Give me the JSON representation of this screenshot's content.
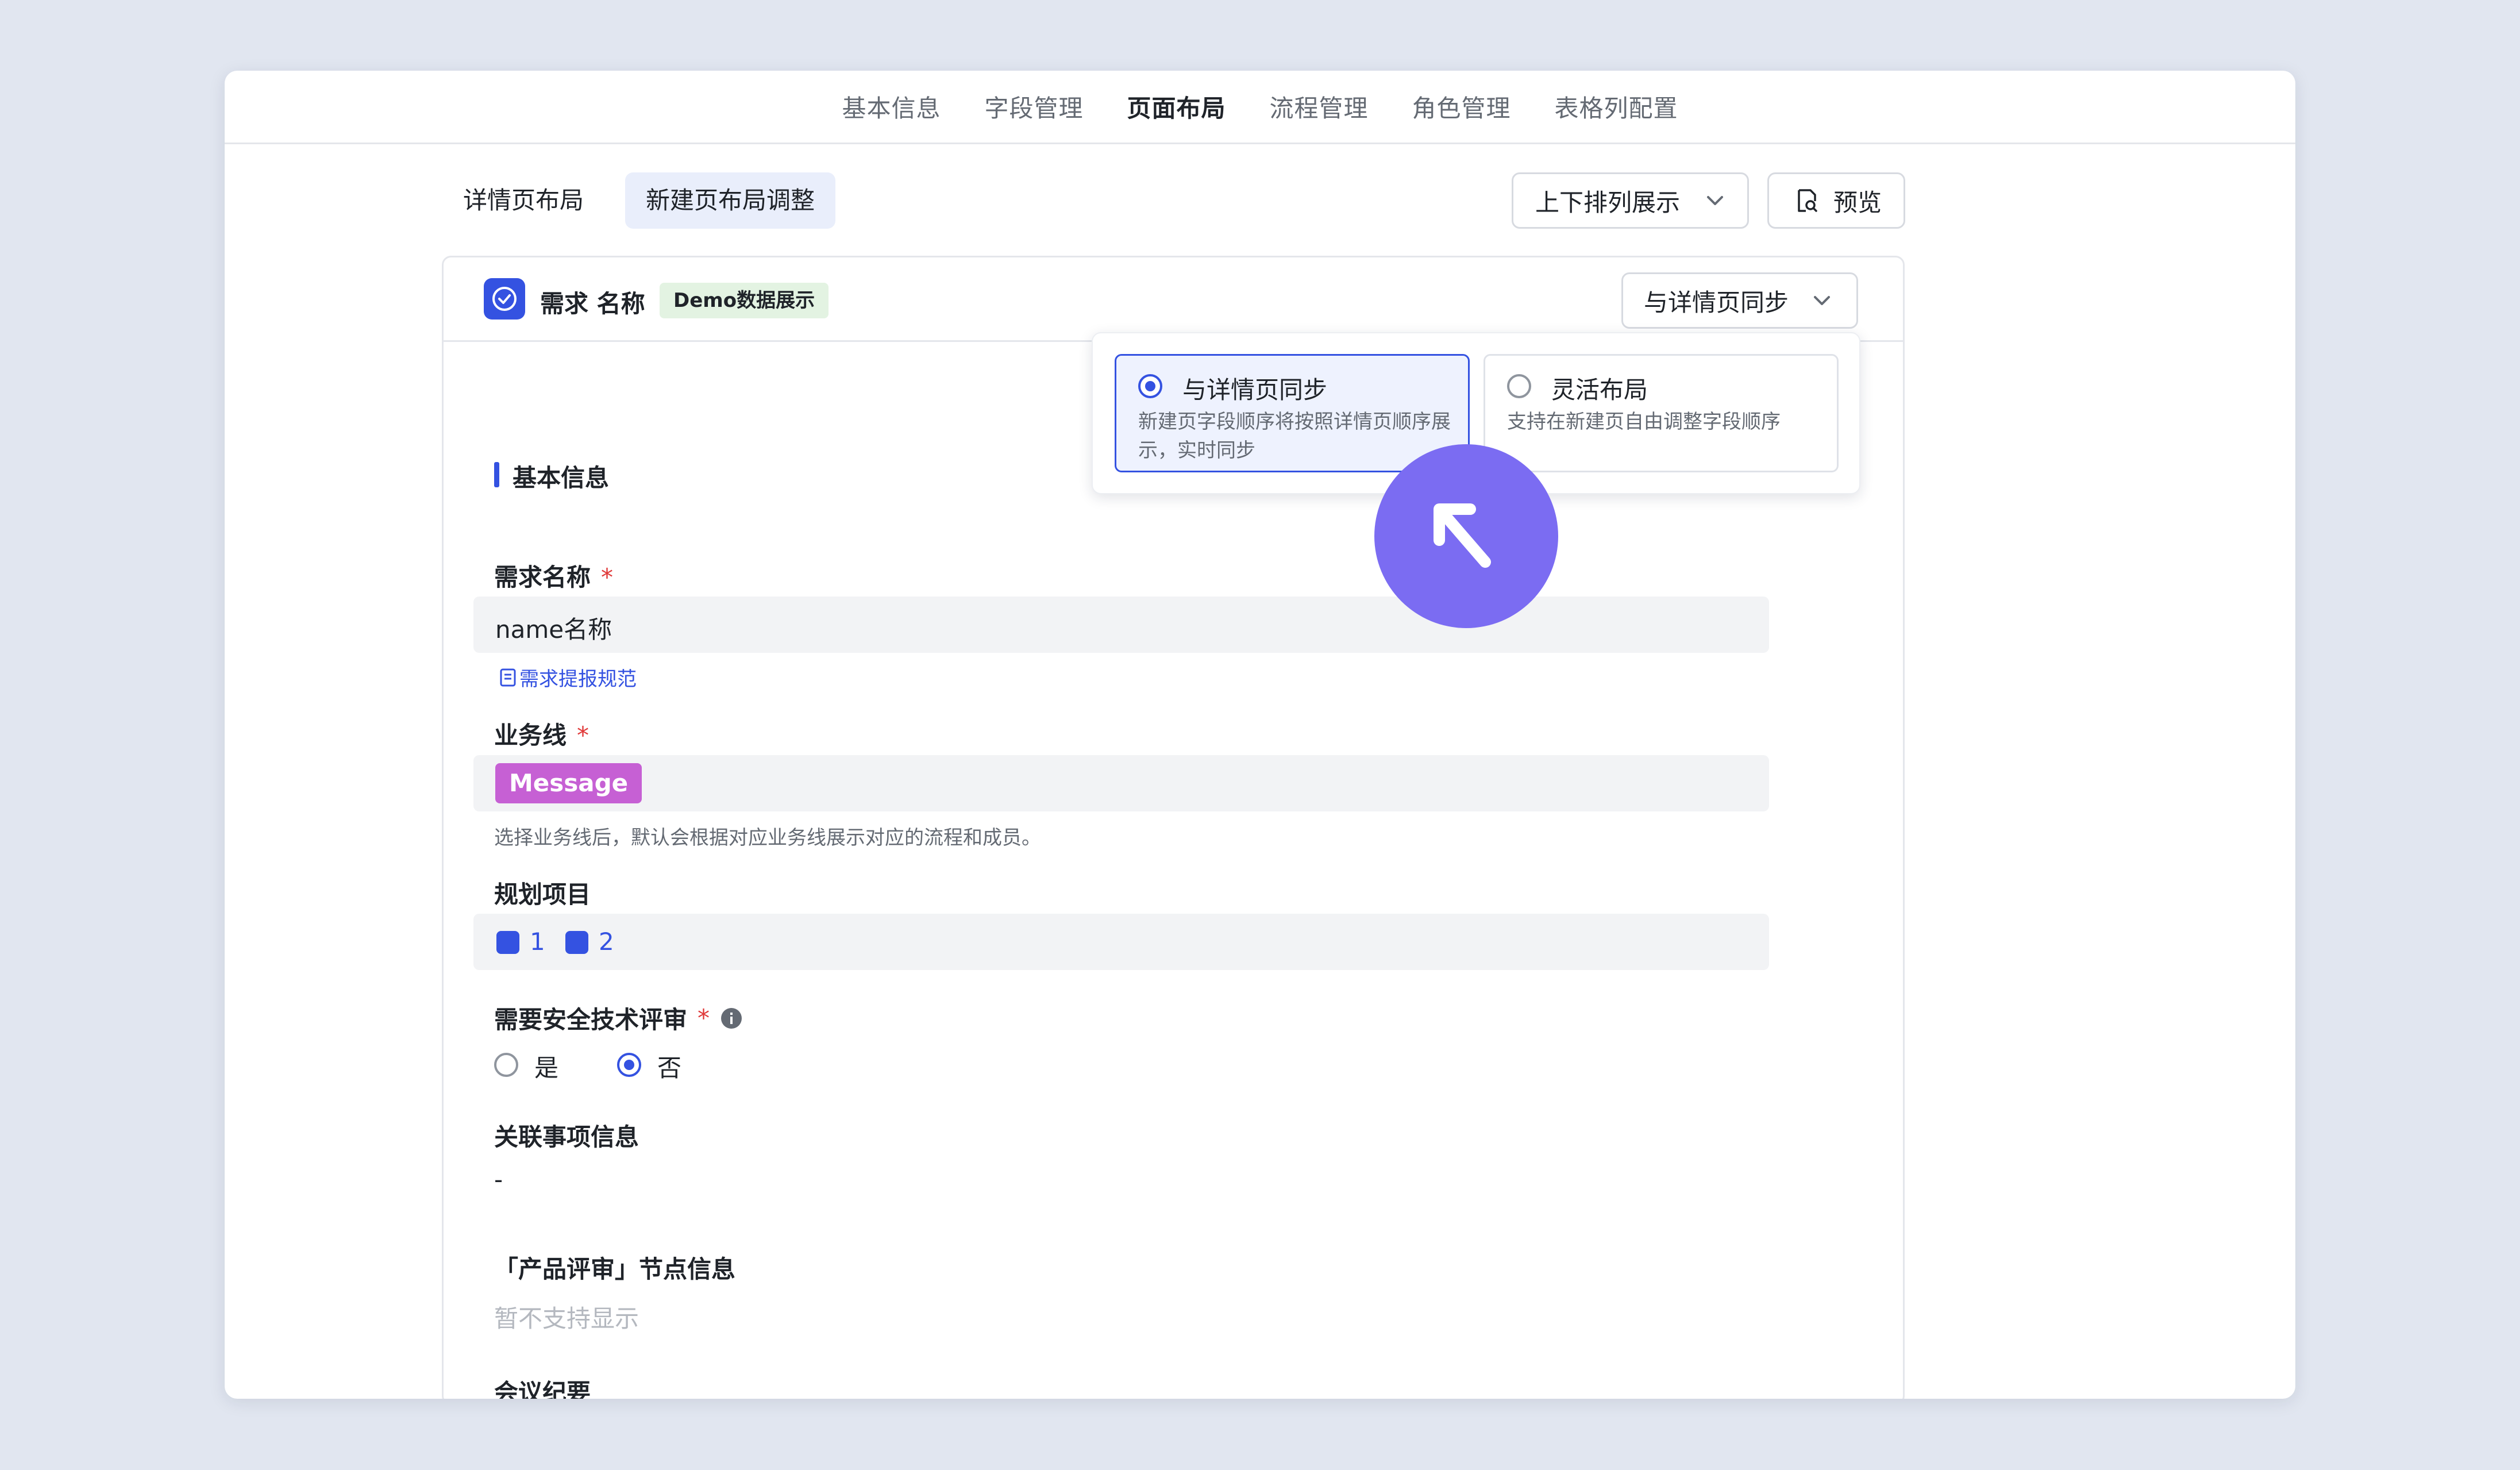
{
  "top_nav": {
    "tabs": [
      "基本信息",
      "字段管理",
      "页面布局",
      "流程管理",
      "角色管理",
      "表格列配置"
    ],
    "active_index": 2
  },
  "sub_tabs": {
    "detail": "详情页布局",
    "new": "新建页布局调整"
  },
  "toolbar": {
    "arrange_label": "上下排列展示",
    "preview_label": "预览"
  },
  "card": {
    "title": "需求 名称",
    "badge": "Demo数据展示",
    "sync_select": "与详情页同步"
  },
  "section_title": "基本信息",
  "fields": {
    "name": {
      "label": "需求名称",
      "required": "*",
      "value": "name名称",
      "link": "需求提报规范"
    },
    "business_line": {
      "label": "业务线",
      "required": "*",
      "tag": "Message",
      "hint": "选择业务线后，默认会根据对应业务线展示对应的流程和成员。"
    },
    "plan_project": {
      "label": "规划项目",
      "items": [
        "1",
        "2"
      ]
    },
    "security_review": {
      "label": "需要安全技术评审",
      "required": "*",
      "options": [
        "是",
        "否"
      ],
      "selected": 1
    },
    "related_info": {
      "label": "关联事项信息",
      "value": "-"
    },
    "product_review": {
      "label": "「产品评审」节点信息",
      "value": "暂不支持显示"
    },
    "meeting": {
      "label": "会议纪要"
    }
  },
  "popover": {
    "options": [
      {
        "title": "与详情页同步",
        "desc": "新建页字段顺序将按照详情页顺序展示，实时同步",
        "selected": true
      },
      {
        "title": "灵活布局",
        "desc": "支持在新建页自由调整字段顺序",
        "selected": false
      }
    ]
  },
  "colors": {
    "accent": "#3452e1",
    "tag_purple": "#c660d4",
    "badge_green_bg": "#e3f3e2",
    "cursor": "#7b6cf2",
    "required": "#e03a3a"
  }
}
